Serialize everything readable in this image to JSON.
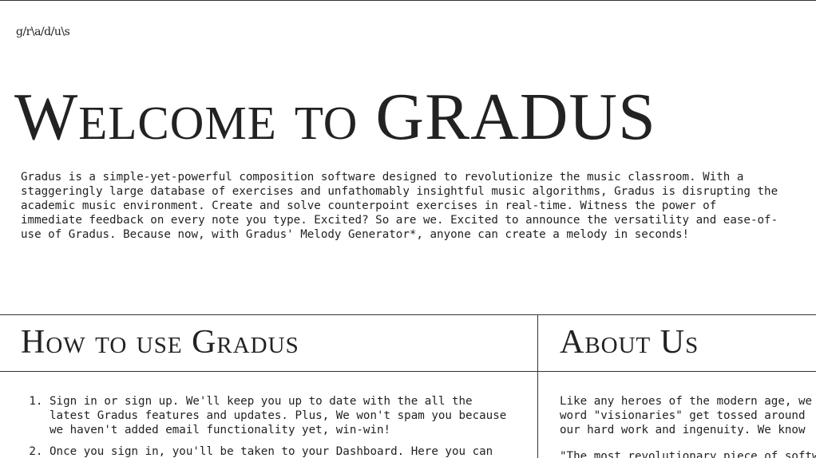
{
  "header": {
    "logo": "g/r\\a/d/u\\s"
  },
  "hero": {
    "title": "Welcome to GRADUS",
    "intro": "Gradus is a simple-yet-powerful composition software designed to revolutionize the music classroom. With a staggeringly large database of exercises and unfathomably insightful music algorithms, Gradus is disrupting the academic music environment. Create and solve counterpoint exercises in real-time. Witness the power of immediate feedback on every note you type. Excited? So are we. Excited to announce the versatility and ease-of-use of Gradus. Because now, with Gradus' Melody Generator*, anyone can create a melody in seconds!"
  },
  "how_to": {
    "title": "How to use Gradus",
    "steps": [
      "Sign in or sign up. We'll keep you up to date with the all the latest Gradus features and updates. Plus, We won't spam you because we haven't added email functionality yet, win-win!",
      "Once you sign in, you'll be taken to your Dashboard. Here you can"
    ]
  },
  "about": {
    "title": "About Us",
    "lines": [
      "Like any heroes of the modern age, we",
      "word \"visionaries\" get tossed around",
      "our hard work and ingenuity. We know"
    ],
    "quote": "\"The most revolutionary piece of softw"
  }
}
